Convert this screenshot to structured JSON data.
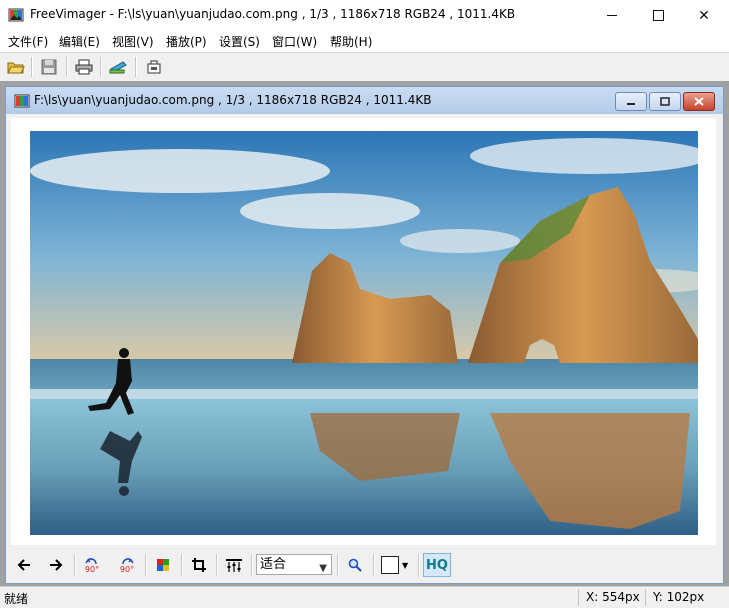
{
  "window": {
    "title": "FreeVimager - F:\\ls\\yuan\\yuanjudao.com.png , 1/3 , 1186x718 RGB24 , 1011.4KB",
    "minimize_icon": "minimize-icon",
    "maximize_icon": "maximize-icon",
    "close_glyph": "✕"
  },
  "menu": {
    "items": [
      {
        "label": "文件(F)"
      },
      {
        "label": "编辑(E)"
      },
      {
        "label": "视图(V)"
      },
      {
        "label": "播放(P)"
      },
      {
        "label": "设置(S)"
      },
      {
        "label": "窗口(W)"
      },
      {
        "label": "帮助(H)"
      }
    ]
  },
  "toolbar": {
    "icons": [
      "open-folder-icon",
      "save-icon",
      "print-icon",
      "scan-icon",
      "capture-icon"
    ]
  },
  "child_window": {
    "title": "F:\\ls\\yuan\\yuanjudao.com.png , 1/3 , 1186x718 RGB24 , 1011.4KB"
  },
  "image_toolbar": {
    "rotate_ccw_label": "90°",
    "rotate_cw_label": "90°",
    "zoom_value": "适合",
    "hq_label": "HQ"
  },
  "status": {
    "text": "就绪",
    "x": "X: 554px",
    "y": "Y: 102px"
  },
  "colors": {
    "mdi_background": "#a0a0a0",
    "child_border": "#7a9cc6",
    "hq_text": "#117a8b"
  }
}
